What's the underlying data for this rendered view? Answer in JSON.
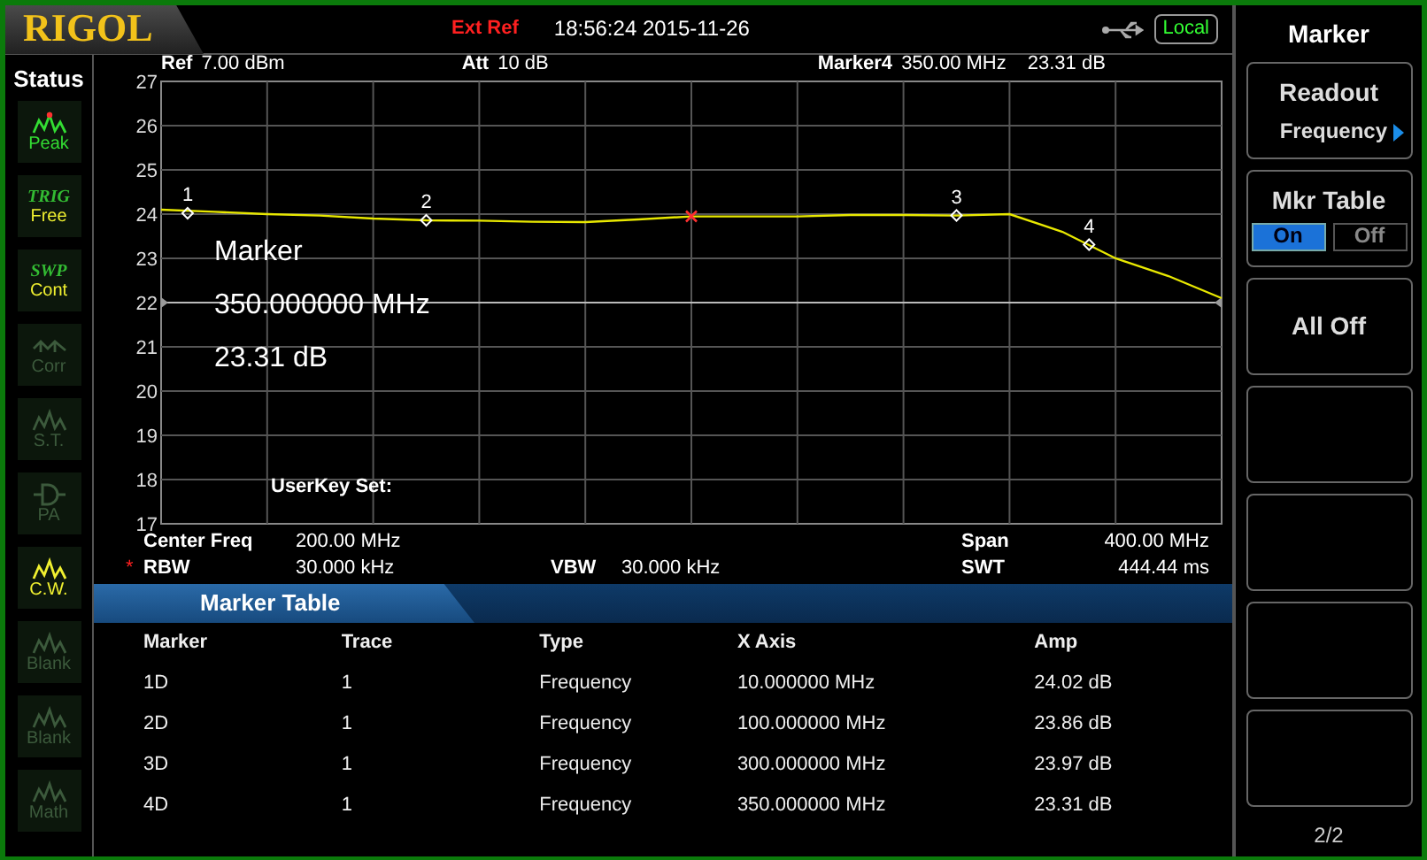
{
  "header": {
    "logo": "RIGOL",
    "ref_source": "Ext Ref",
    "datetime": "18:56:24 2015-11-26",
    "remote_state": "Local"
  },
  "status": {
    "title": "Status",
    "items": [
      {
        "kind": "wave",
        "label": "Peak",
        "color": "#33dd33",
        "peak_dot": true
      },
      {
        "kind": "title",
        "title": "TRIG",
        "label": "Free",
        "color": "#f0f030",
        "peak_dot": false
      },
      {
        "kind": "title",
        "title": "SWP",
        "label": "Cont",
        "color": "#f0f030",
        "peak_dot": false
      },
      {
        "kind": "corr",
        "label": "Corr",
        "color": "#3c5a3c",
        "peak_dot": false
      },
      {
        "kind": "wave",
        "label": "S.T.",
        "color": "#3c5a3c",
        "peak_dot": false
      },
      {
        "kind": "amp",
        "label": "PA",
        "color": "#3c5a3c",
        "peak_dot": false
      },
      {
        "kind": "wave",
        "label": "C.W.",
        "color": "#f0f030",
        "peak_dot": false
      },
      {
        "kind": "wave",
        "label": "Blank",
        "color": "#3c5a3c",
        "peak_dot": false
      },
      {
        "kind": "wave",
        "label": "Blank",
        "color": "#3c5a3c",
        "peak_dot": false
      },
      {
        "kind": "wave",
        "label": "Math",
        "color": "#3c5a3c",
        "peak_dot": false
      }
    ]
  },
  "plot": {
    "ref_label": "Ref",
    "ref_value": "7.00 dBm",
    "att_label": "Att",
    "att_value": "10 dB",
    "marker_label": "Marker4",
    "marker_freq": "350.00 MHz",
    "marker_amp": "23.31 dB",
    "readout": [
      "Marker",
      "350.000000 MHz",
      "23.31 dB"
    ],
    "userkey": "UserKey Set:",
    "chart_data": {
      "type": "line",
      "categories": [
        null,
        null,
        null,
        null,
        null,
        null,
        null,
        null,
        null,
        null,
        null,
        null,
        null,
        null,
        null,
        null,
        null,
        null,
        null,
        null,
        null
      ],
      "series": [
        {
          "color": "#e8e800",
          "values": [
            24.1,
            24.05,
            24.0,
            23.97,
            23.9,
            23.86,
            23.85,
            23.83,
            23.82,
            23.88,
            23.95,
            23.95,
            23.95,
            23.98,
            23.98,
            23.97,
            24.0,
            23.6,
            23.0,
            22.6,
            22.1
          ]
        }
      ],
      "ylim": [
        17,
        27
      ],
      "yticks": [
        17,
        18,
        19,
        20,
        21,
        22,
        23,
        24,
        25,
        26,
        27
      ],
      "grid": true,
      "ref_lines": [
        {
          "axis": "y",
          "value": 22,
          "color": "#bbbbbb"
        }
      ],
      "annotations": [
        {
          "text": "1",
          "y": 24.02
        },
        {
          "text": "2",
          "y": 23.86
        },
        {
          "text": "3",
          "y": 23.97
        },
        {
          "text": "4",
          "y": 23.31
        }
      ]
    }
  },
  "param_rows": [
    {
      "left": {
        "label": "Center Freq",
        "value": "200.00 MHz"
      },
      "right": {
        "label": "Span",
        "value": "400.00 MHz"
      }
    },
    {
      "left": {
        "flag": "*",
        "label": "RBW",
        "value": "30.000 kHz"
      },
      "middle": {
        "label": "VBW",
        "value": "30.000 kHz"
      },
      "right": {
        "label": "SWT",
        "value": "444.44 ms"
      }
    }
  ],
  "marker_table": {
    "title": "Marker Table",
    "columns": [
      "Marker",
      "Trace",
      "Type",
      "X Axis",
      "Amp"
    ],
    "rows": [
      [
        "1D",
        "1",
        "Frequency",
        "10.000000 MHz",
        "24.02 dB"
      ],
      [
        "2D",
        "1",
        "Frequency",
        "100.000000 MHz",
        "23.86 dB"
      ],
      [
        "3D",
        "1",
        "Frequency",
        "300.000000 MHz",
        "23.97 dB"
      ],
      [
        "4D",
        "1",
        "Frequency",
        "350.000000 MHz",
        "23.31 dB"
      ]
    ]
  },
  "menu": {
    "title": "Marker",
    "buttons": [
      {
        "kind": "submenu",
        "label": "Readout",
        "value": "Frequency"
      },
      {
        "kind": "toggle",
        "label": "Mkr Table",
        "options": [
          {
            "label": "On",
            "selected": true
          },
          {
            "label": "Off",
            "selected": false
          }
        ]
      },
      {
        "kind": "action",
        "label": "All Off"
      },
      {
        "kind": "empty"
      },
      {
        "kind": "empty"
      },
      {
        "kind": "empty"
      },
      {
        "kind": "empty"
      }
    ],
    "page": "2/2"
  }
}
